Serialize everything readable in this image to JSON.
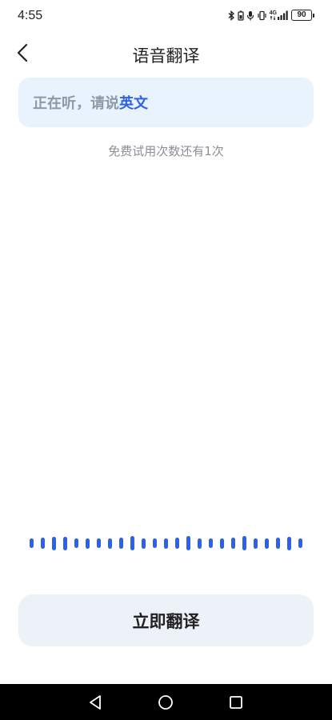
{
  "status_bar": {
    "time": "4:55",
    "battery_level": "90",
    "network_label": "4G",
    "icons": [
      "bluetooth-icon",
      "battery-saver-icon",
      "microphone-icon",
      "vibrate-icon",
      "signal-4g-icon",
      "battery-icon"
    ]
  },
  "header": {
    "title": "语音翻译",
    "back_icon": "chevron-left-icon"
  },
  "listen_card": {
    "prefix": "正在听，请说",
    "language": "英文"
  },
  "trial_note": "免费试用次数还有1次",
  "waveform": {
    "levels": [
      0.45,
      0.55,
      0.65,
      0.65,
      0.45,
      0.5,
      0.45,
      0.5,
      0.55,
      0.7,
      0.5,
      0.45,
      0.5,
      0.55,
      0.7,
      0.5,
      0.45,
      0.5,
      0.55,
      0.7,
      0.5,
      0.5,
      0.55,
      0.65,
      0.45
    ]
  },
  "translate_button": {
    "label": "立即翻译"
  },
  "nav_bar": {
    "back_icon": "triangle-back-icon",
    "home_icon": "circle-home-icon",
    "recents_icon": "square-recents-icon"
  },
  "colors": {
    "accent": "#2f61e6",
    "card_bg": "#e9f3fe",
    "button_bg": "#edf1f8",
    "muted_text": "#8a8f96"
  }
}
